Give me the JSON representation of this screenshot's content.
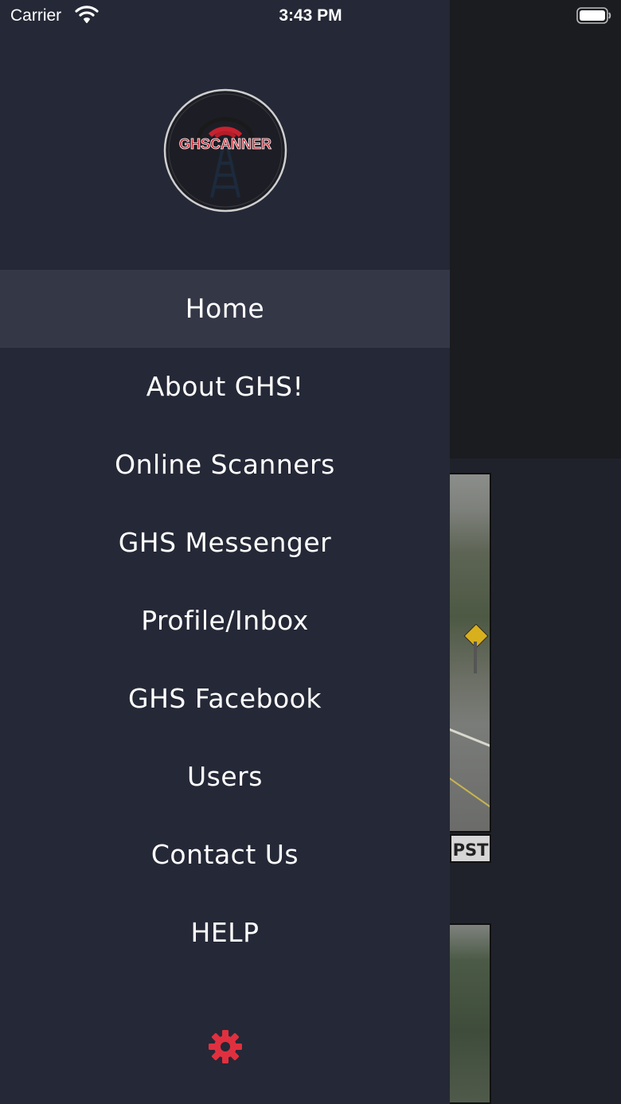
{
  "status_bar": {
    "carrier": "Carrier",
    "time": "3:43 PM"
  },
  "logo": {
    "text": "GHSCANNER"
  },
  "menu": {
    "items": [
      {
        "label": "Home",
        "active": true
      },
      {
        "label": "About GHS!"
      },
      {
        "label": "Online Scanners"
      },
      {
        "label": "GHS Messenger"
      },
      {
        "label": "Profile/Inbox"
      },
      {
        "label": "GHS Facebook"
      },
      {
        "label": "Users"
      },
      {
        "label": "Contact Us"
      },
      {
        "label": "HELP"
      }
    ]
  },
  "background": {
    "camera_timezone": "PST"
  },
  "colors": {
    "drawer_bg": "#252836",
    "active_item_bg": "#343746",
    "accent_red": "#e0303f"
  },
  "icons": [
    "wifi-icon",
    "battery-icon",
    "settings-gear-icon"
  ]
}
